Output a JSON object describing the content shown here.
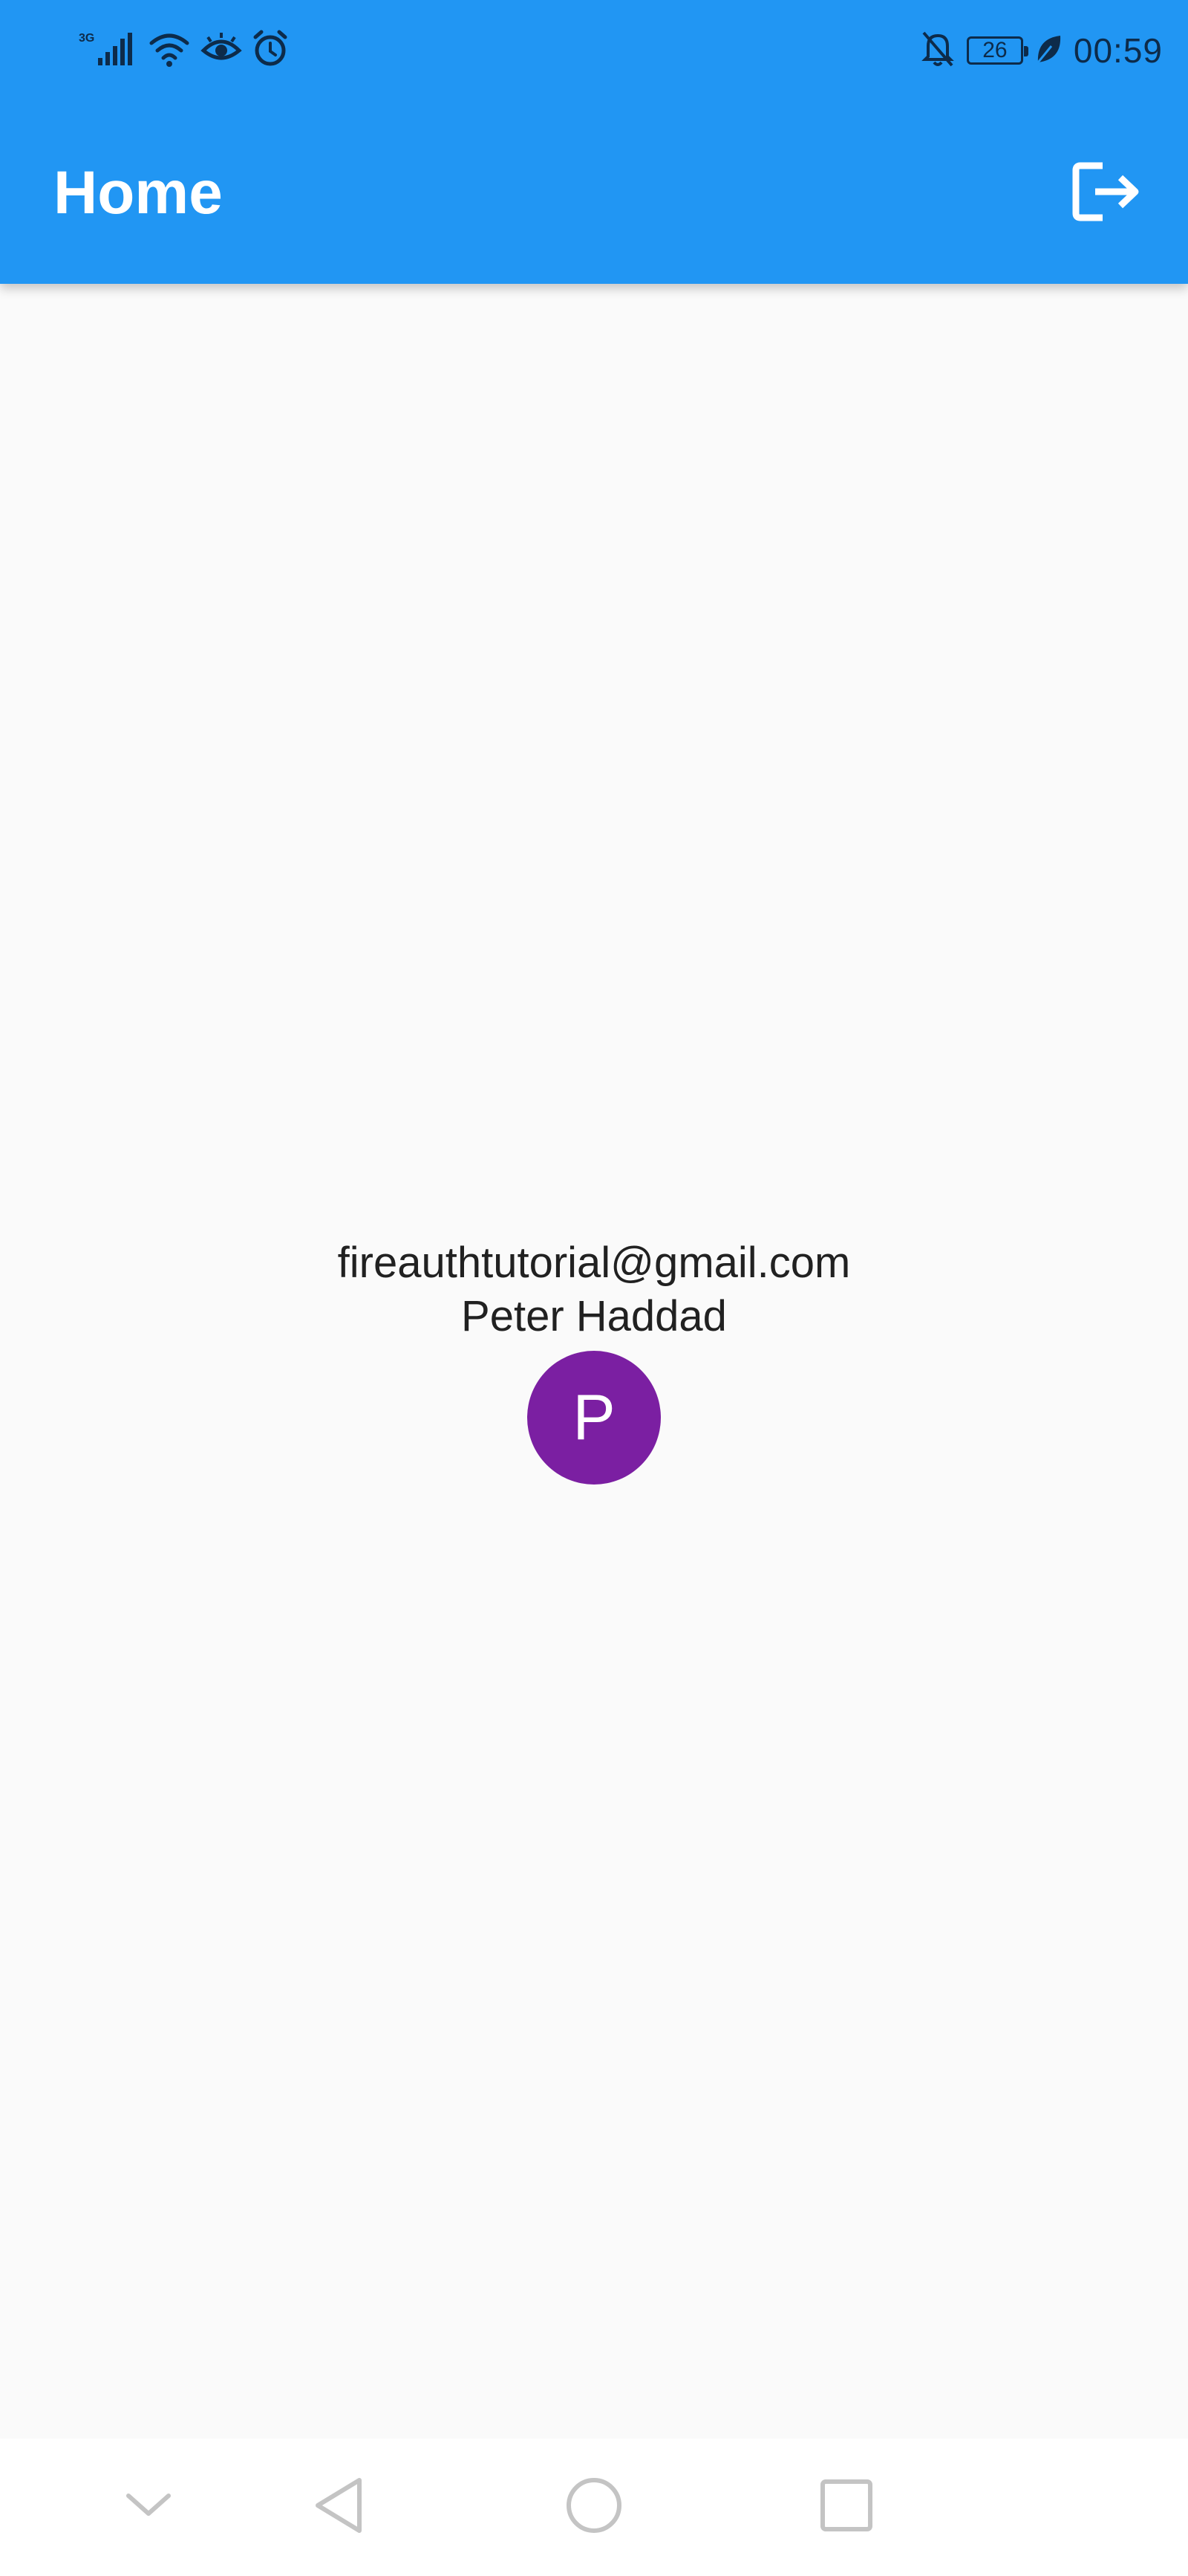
{
  "status_bar": {
    "network_label": "3G",
    "battery_level": "26",
    "time": "00:59",
    "icons": [
      "signal-icon",
      "wifi-icon",
      "eye-icon",
      "alarm-icon",
      "bell-off-icon",
      "battery-icon",
      "leaf-icon"
    ]
  },
  "app_bar": {
    "title": "Home",
    "action_icon": "logout-icon",
    "color": "#2196f3"
  },
  "profile": {
    "email": "fireauthtutorial@gmail.com",
    "name": "Peter Haddad",
    "avatar_initial": "P",
    "avatar_color": "#7b1fa2"
  },
  "nav_bar": {
    "buttons": [
      "hide-keyboard-icon",
      "back-icon",
      "home-icon",
      "recents-icon"
    ]
  }
}
